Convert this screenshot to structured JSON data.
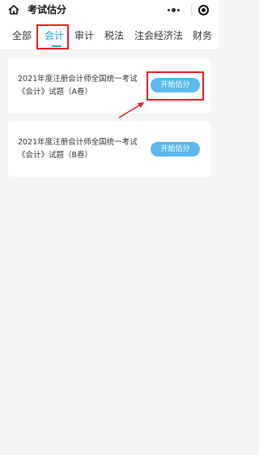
{
  "navbar": {
    "title": "考试估分",
    "home_icon": "home-icon",
    "more_icon": "more-dots-icon",
    "close_icon": "target-icon"
  },
  "tabs": [
    {
      "label": "全部",
      "active": false
    },
    {
      "label": "会计",
      "active": true
    },
    {
      "label": "审计",
      "active": false
    },
    {
      "label": "税法",
      "active": false
    },
    {
      "label": "注会经济法",
      "active": false
    },
    {
      "label": "财务",
      "active": false
    }
  ],
  "exams": [
    {
      "title": "2021年度注册会计师全国统一考试《会计》试题（A卷）",
      "button_label": "开始估分"
    },
    {
      "title": "2021年度注册会计师全国统一考试《会计》试题（B卷）",
      "button_label": "开始估分"
    }
  ],
  "colors": {
    "accent": "#1aa1e8",
    "button": "#5bb8f0",
    "annotation": "#e02020",
    "background": "#f5f5f5"
  }
}
